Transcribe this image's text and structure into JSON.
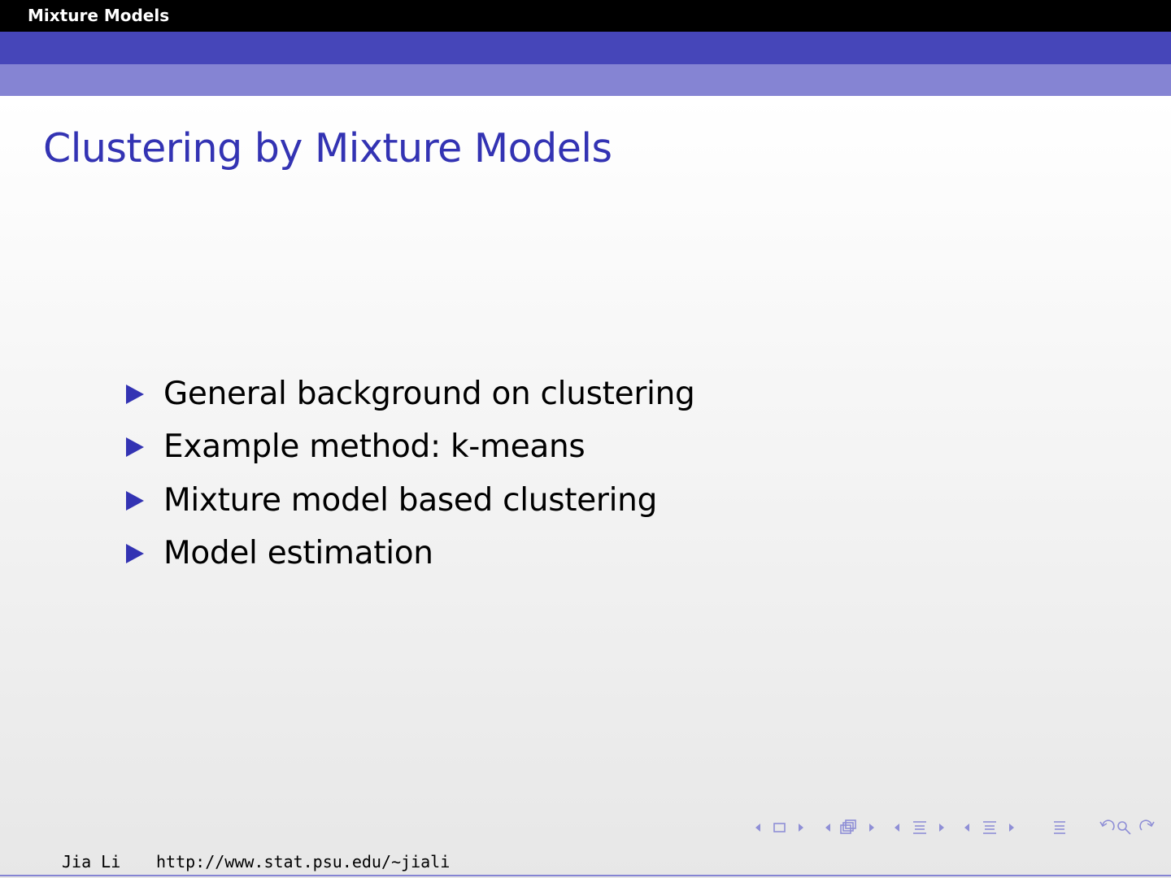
{
  "header": {
    "section_title": "Mixture Models"
  },
  "frame": {
    "title": "Clustering by Mixture Models",
    "items": [
      {
        "text": "General background on clustering"
      },
      {
        "text": "Example method: k-means"
      },
      {
        "text": "Mixture model based clustering"
      },
      {
        "text": "Model estimation"
      }
    ]
  },
  "footer": {
    "author": "Jia Li",
    "url": "http://www.stat.psu.edu/∼jiali"
  },
  "colors": {
    "title": "#3333b3",
    "bullet": "#3333b3",
    "header_band_dark": "#4646b9",
    "header_band_light": "#8584d3",
    "nav_symbols": "#8f8fd6"
  },
  "icons": {
    "bullet": "triangle-right-icon",
    "nav": [
      "frame-back-icon",
      "frame-icon",
      "frame-forward-icon",
      "subsection-back-icon",
      "subsection-icon",
      "subsection-forward-icon",
      "section-back-icon",
      "section-icon",
      "section-forward-icon",
      "section-back-icon",
      "section-icon",
      "section-forward-icon",
      "document-icon",
      "back-icon",
      "search-icon",
      "forward-icon"
    ]
  }
}
